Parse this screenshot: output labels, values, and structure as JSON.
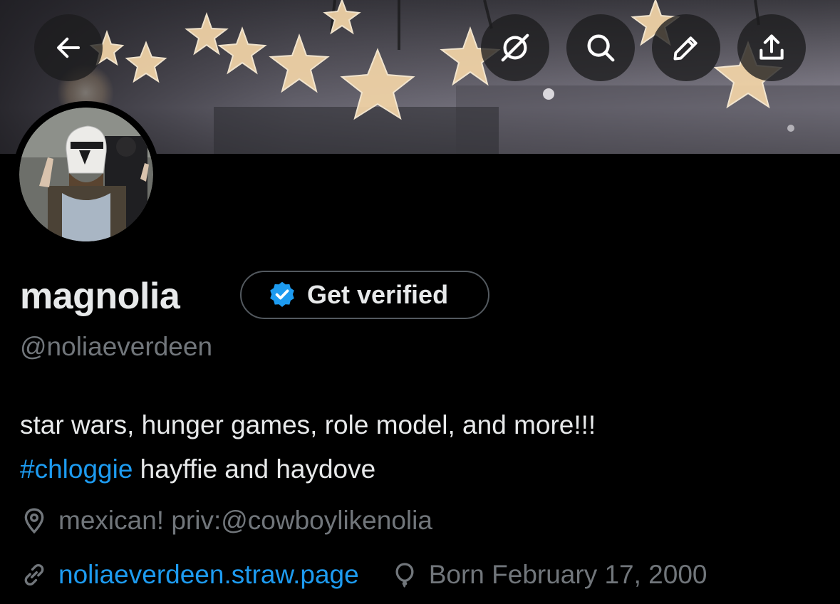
{
  "header": {
    "back_icon": "arrow-left-icon",
    "grok_icon": "grok-icon",
    "search_icon": "search-icon",
    "edit_icon": "pencil-icon",
    "share_icon": "share-icon"
  },
  "profile": {
    "display_name": "magnolia",
    "get_verified_label": "Get verified",
    "handle": "@noliaeverdeen",
    "bio_line1": "star wars, hunger games, role model, and more!!!",
    "bio_hashtag": "#chloggie",
    "bio_line2_rest": " hayffie and haydove",
    "location": "mexican! priv:@cowboylikenolia",
    "website": "noliaeverdeen.straw.page",
    "birthday": "Born February 17, 2000"
  },
  "colors": {
    "background": "#000000",
    "accent": "#1d9bf0",
    "secondary_text": "#71767b",
    "primary_text": "#e7e9ea"
  }
}
